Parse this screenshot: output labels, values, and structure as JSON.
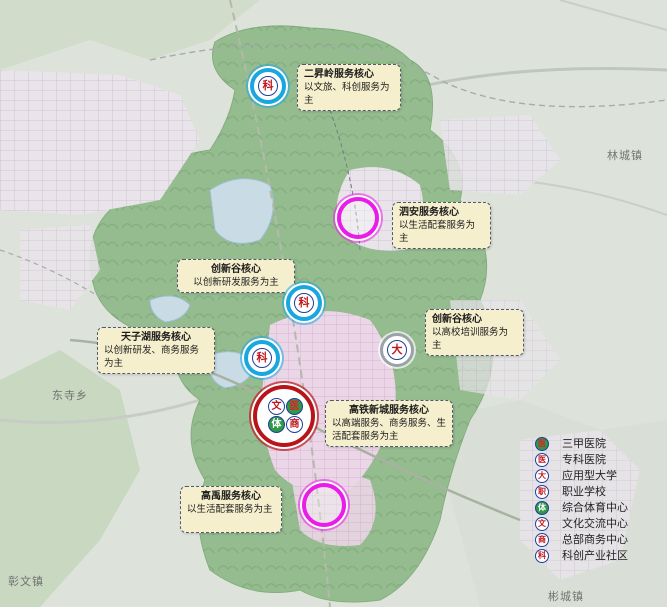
{
  "map": {
    "place_labels": [
      "林城镇",
      "东寺乡",
      "彰文镇",
      "彬城镇"
    ],
    "centers": [
      {
        "key": "erhun",
        "title": "二昇岭服务核心",
        "desc": "以文旅、科创服务为主",
        "badges": [
          "科"
        ]
      },
      {
        "key": "sian",
        "title": "泗安服务核心",
        "desc": "以生活配套服务为主",
        "badges": []
      },
      {
        "key": "chuangxin_w",
        "title": "创新谷核心",
        "desc": "以创新研发服务为主",
        "badges": [
          "科"
        ]
      },
      {
        "key": "chuangxin_e",
        "title": "创新谷核心",
        "desc": "以高校培训服务为主",
        "badges": [
          "大"
        ]
      },
      {
        "key": "tianzihu",
        "title": "天子湖服务核心",
        "desc": "以创新研发、商务服务为主",
        "badges": [
          "科"
        ]
      },
      {
        "key": "gaotie",
        "title": "高铁新城服务核心",
        "desc": "以高端服务、商务服务、生活配套服务为主",
        "badges": [
          "文",
          "医",
          "体",
          "商"
        ]
      },
      {
        "key": "gaoyu",
        "title": "高禹服务核心",
        "desc": "以生活配套服务为主",
        "badges": []
      }
    ],
    "colors": {
      "ring_blue": "#1aa6de",
      "ring_magenta": "#e81ee8",
      "ring_red": "#b8151b",
      "callout_bg": "#f6efcd"
    }
  },
  "legend": {
    "items": [
      {
        "glyph": "医",
        "label": "三甲医院",
        "style": "greenred"
      },
      {
        "glyph": "医",
        "label": "专科医院",
        "style": "white"
      },
      {
        "glyph": "大",
        "label": "应用型大学",
        "style": "white"
      },
      {
        "glyph": "职",
        "label": "职业学校",
        "style": "white"
      },
      {
        "glyph": "体",
        "label": "综合体育中心",
        "style": "green"
      },
      {
        "glyph": "文",
        "label": "文化交流中心",
        "style": "white"
      },
      {
        "glyph": "商",
        "label": "总部商务中心",
        "style": "white"
      },
      {
        "glyph": "科",
        "label": "科创产业社区",
        "style": "white"
      }
    ]
  }
}
